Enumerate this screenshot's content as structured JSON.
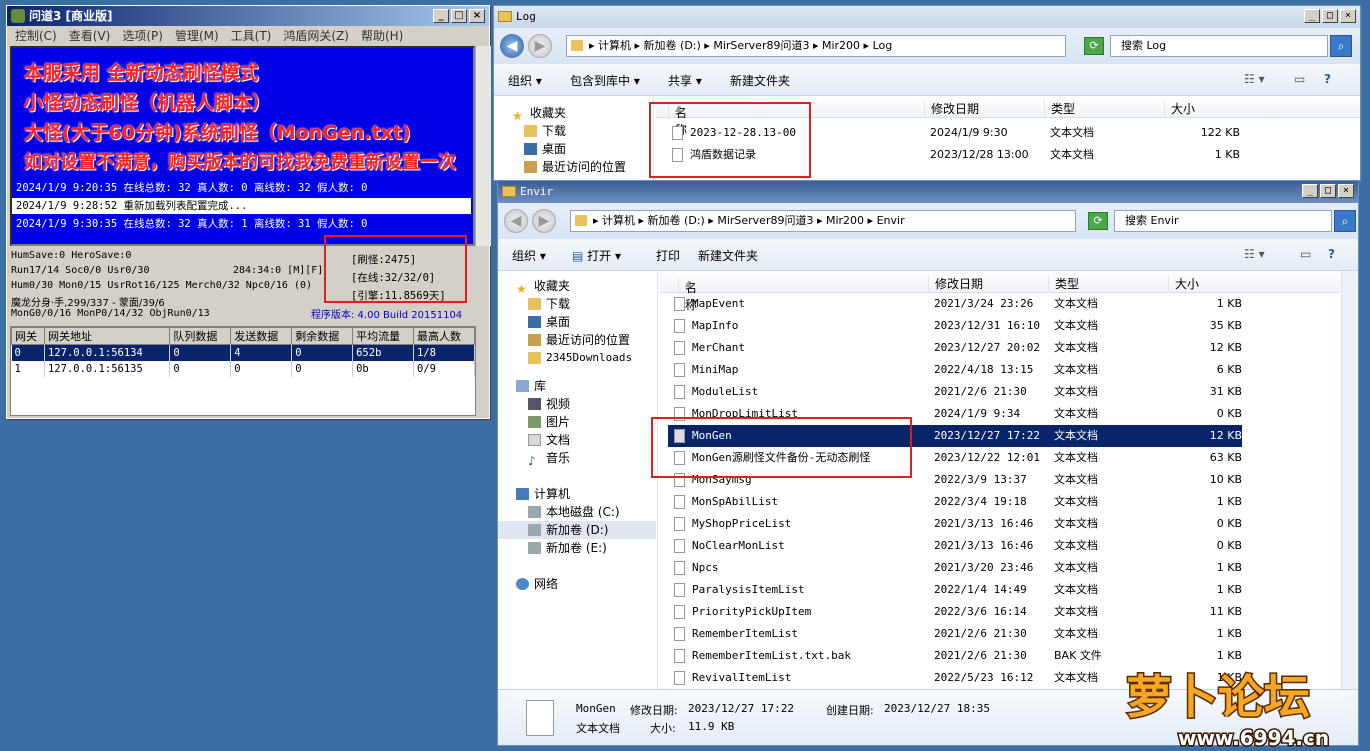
{
  "left_window": {
    "title": "问道3 [商业版]",
    "menu": [
      "控制(C)",
      "查看(V)",
      "选项(P)",
      "管理(M)",
      "工具(T)",
      "鸿盾网关(Z)",
      "帮助(H)"
    ],
    "promo_lines": [
      "本服采用 全新动态刷怪模式",
      "小怪动态刷怪（机器人脚本）",
      "大怪(大于60分钟)系统刷怪（MonGen.txt)",
      "如对设置不满意，购买版本的可找我免费重新设置一次"
    ],
    "log_lines": [
      "2024/1/9 9:20:35 在线总数: 32 真人数: 0 离线数: 32 假人数: 0",
      "2024/1/9 9:28:52 重新加载列表配置完成...",
      "2024/1/9 9:30:35 在线总数: 32 真人数: 1 离线数: 31 假人数: 0"
    ],
    "stats": {
      "line1": "HumSave:0 HeroSave:0",
      "line2": "Run17/14 Soc0/0 Usr0/30",
      "line2b": "284:34:0 [M][F]",
      "line3": "Hum0/30 Mon0/15 UsrRot16/125 Merch0/32 Npc0/16 (0)",
      "line4": "魔龙分身·手,299/337 - 蒙面/39/6",
      "line5": "MonG0/0/16 MonP0/14/32 ObjRun0/13",
      "refresh_count": "[刷怪:2475]",
      "online": "[在线:32/32/0]",
      "engine": "[引擎:11.8569天]",
      "version": "程序版本: 4.00 Build 20151104"
    },
    "gateway_table": {
      "headers": [
        "网关",
        "网关地址",
        "队列数据",
        "发送数据",
        "剩余数据",
        "平均流量",
        "最高人数"
      ],
      "rows": [
        [
          "0",
          "127.0.0.1:56134",
          "0",
          "4",
          "0",
          "652b",
          "1/8"
        ],
        [
          "1",
          "127.0.0.1:56135",
          "0",
          "0",
          "0",
          "0b",
          "0/9"
        ]
      ]
    }
  },
  "log_window": {
    "title": "Log",
    "address": [
      "计算机",
      "新加卷 (D:)",
      "MirServer89问道3",
      "Mir200",
      "Log"
    ],
    "search_placeholder": "搜索 Log",
    "toolbar": [
      "组织",
      "包含到库中",
      "共享",
      "新建文件夹"
    ],
    "nav": [
      "收藏夹",
      "下载",
      "桌面",
      "最近访问的位置"
    ],
    "columns": [
      "名称",
      "修改日期",
      "类型",
      "大小"
    ],
    "files": [
      {
        "name": "2023-12-28.13-00",
        "date": "2024/1/9 9:30",
        "type": "文本文档",
        "size": "122 KB"
      },
      {
        "name": "鸿盾数据记录",
        "date": "2023/12/28 13:00",
        "type": "文本文档",
        "size": "1 KB"
      }
    ]
  },
  "envir_window": {
    "title": "Envir",
    "address": [
      "计算机",
      "新加卷 (D:)",
      "MirServer89问道3",
      "Mir200",
      "Envir"
    ],
    "search_placeholder": "搜索 Envir",
    "toolbar": [
      "组织",
      "打开",
      "打印",
      "新建文件夹"
    ],
    "nav": {
      "favorites": [
        "收藏夹",
        "下载",
        "桌面",
        "最近访问的位置",
        "2345Downloads"
      ],
      "libraries": [
        "库",
        "视频",
        "图片",
        "文档",
        "音乐"
      ],
      "computer": [
        "计算机",
        "本地磁盘 (C:)",
        "新加卷 (D:)",
        "新加卷 (E:)"
      ],
      "network": "网络"
    },
    "columns": [
      "名称",
      "修改日期",
      "类型",
      "大小"
    ],
    "files": [
      {
        "name": "MapEvent",
        "date": "2021/3/24 23:26",
        "type": "文本文档",
        "size": "1 KB"
      },
      {
        "name": "MapInfo",
        "date": "2023/12/31 16:10",
        "type": "文本文档",
        "size": "35 KB"
      },
      {
        "name": "MerChant",
        "date": "2023/12/27 20:02",
        "type": "文本文档",
        "size": "12 KB"
      },
      {
        "name": "MiniMap",
        "date": "2022/4/18 13:15",
        "type": "文本文档",
        "size": "6 KB"
      },
      {
        "name": "ModuleList",
        "date": "2021/2/6 21:30",
        "type": "文本文档",
        "size": "31 KB"
      },
      {
        "name": "MonDropLimitList",
        "date": "2024/1/9 9:34",
        "type": "文本文档",
        "size": "0 KB"
      },
      {
        "name": "MonGen",
        "date": "2023/12/27 17:22",
        "type": "文本文档",
        "size": "12 KB"
      },
      {
        "name": "MonGen源刷怪文件备份-无动态刷怪",
        "date": "2023/12/22 12:01",
        "type": "文本文档",
        "size": "63 KB"
      },
      {
        "name": "MonSaymsg",
        "date": "2022/3/9 13:37",
        "type": "文本文档",
        "size": "10 KB"
      },
      {
        "name": "MonSpAbilList",
        "date": "2022/3/4 19:18",
        "type": "文本文档",
        "size": "1 KB"
      },
      {
        "name": "MyShopPriceList",
        "date": "2021/3/13 16:46",
        "type": "文本文档",
        "size": "0 KB"
      },
      {
        "name": "NoClearMonList",
        "date": "2021/3/13 16:46",
        "type": "文本文档",
        "size": "0 KB"
      },
      {
        "name": "Npcs",
        "date": "2021/3/20 23:46",
        "type": "文本文档",
        "size": "1 KB"
      },
      {
        "name": "ParalysisItemList",
        "date": "2022/1/4 14:49",
        "type": "文本文档",
        "size": "1 KB"
      },
      {
        "name": "PriorityPickUpItem",
        "date": "2022/3/6 16:14",
        "type": "文本文档",
        "size": "11 KB"
      },
      {
        "name": "RememberItemList",
        "date": "2021/2/6 21:30",
        "type": "文本文档",
        "size": "1 KB"
      },
      {
        "name": "RememberItemList.txt.bak",
        "date": "2021/2/6 21:30",
        "type": "BAK 文件",
        "size": "1 KB"
      },
      {
        "name": "RevivalItemList",
        "date": "2022/5/23 16:12",
        "type": "文本文档",
        "size": "1 KB"
      }
    ],
    "details": {
      "name": "MonGen",
      "modified_label": "修改日期:",
      "modified": "2023/12/27 17:22",
      "created_label": "创建日期:",
      "created": "2023/12/27 18:35",
      "type": "文本文档",
      "size_label": "大小:",
      "size": "11.9 KB"
    }
  },
  "watermark": {
    "brand": "萝卜论坛",
    "url": "www.6994.cn"
  },
  "colors": {
    "desktop": "#3a6ea5",
    "selection": "#0a246a",
    "highlight_box": "#e02020",
    "log_bg": "#0000e6"
  }
}
